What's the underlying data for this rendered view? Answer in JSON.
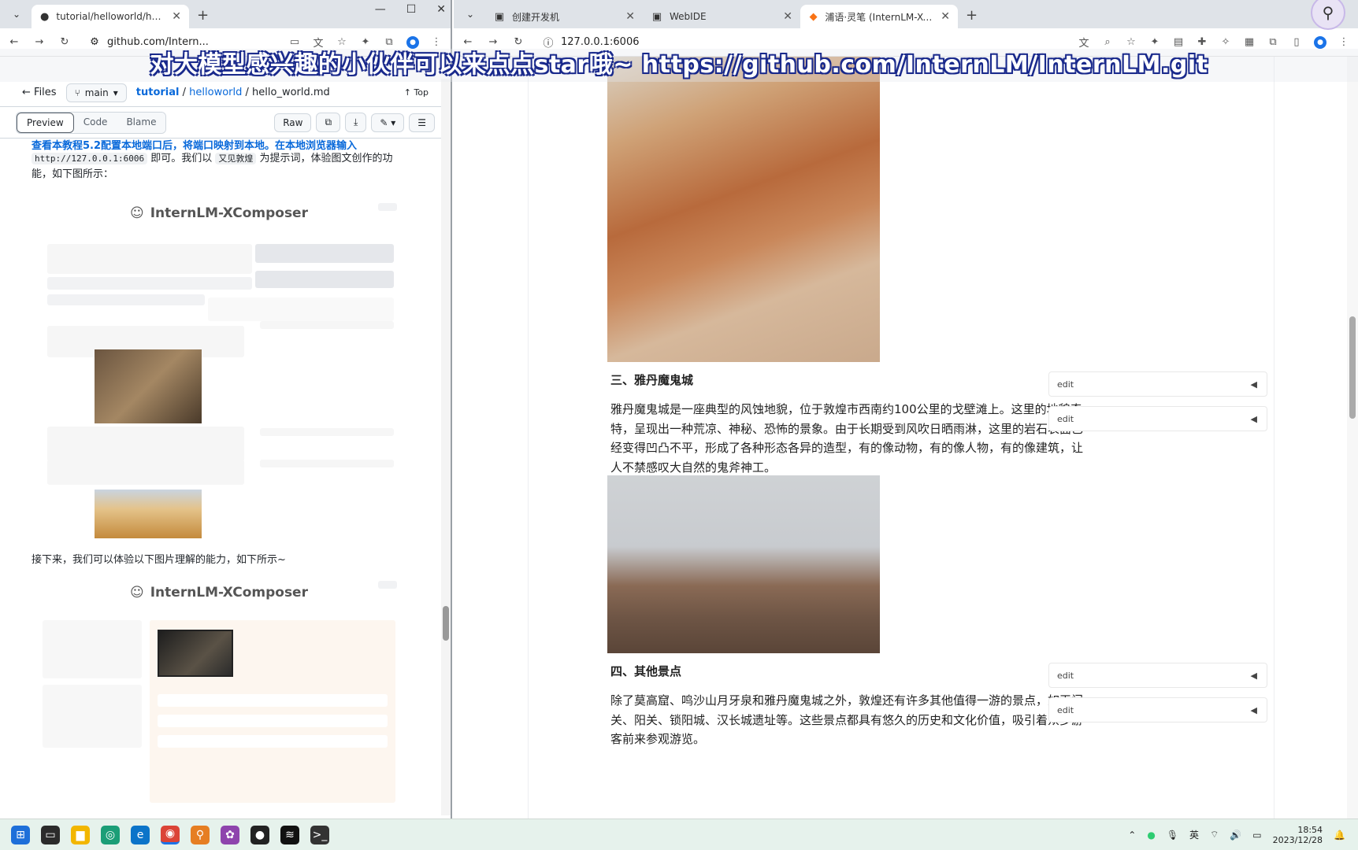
{
  "left_browser": {
    "tab_title": "tutorial/helloworld/hello_wo",
    "url": "github.com/Intern...",
    "github": {
      "files_label": "Files",
      "branch": "main",
      "breadcrumb": [
        "tutorial",
        "helloworld",
        "hello_world.md"
      ],
      "top_label": "Top",
      "view_tabs": [
        "Preview",
        "Code",
        "Blame"
      ],
      "raw_label": "Raw",
      "text_line1": "查看本教程5.2配置本地端口后，将端口映射到本地。在本地浏览器输入",
      "text_code": "http://127.0.0.1:6006",
      "text_line1_tail": "即可。我们以",
      "text_keyword": "又见敦煌",
      "text_line1_end": "为提示词，体验图文创作的功",
      "text_line2": "能，如下图所示：",
      "screenshot_title_1": "InternLM-XComposer",
      "screenshot_title_2": "InternLM-XComposer",
      "next_text": "接下来，我们可以体验以下图片理解的能力，如下所示~"
    }
  },
  "right_browser": {
    "tabs": [
      {
        "title": "创建开发机"
      },
      {
        "title": "WebIDE"
      },
      {
        "title": "浦语·灵笔 (InternLM-XCompo"
      }
    ],
    "url": "127.0.0.1:6006",
    "article": {
      "section3_heading": "三、雅丹魔鬼城",
      "section3_para": "雅丹魔鬼城是一座典型的风蚀地貌，位于敦煌市西南约100公里的戈壁滩上。这里的地貌奇特，呈现出一种荒凉、神秘、恐怖的景象。由于长期受到风吹日晒雨淋，这里的岩石表面已经变得凹凸不平，形成了各种形态各异的造型，有的像动物，有的像人物，有的像建筑，让人不禁感叹大自然的鬼斧神工。",
      "section4_heading": "四、其他景点",
      "section4_para": "除了莫高窟、鸣沙山月牙泉和雅丹魔鬼城之外，敦煌还有许多其他值得一游的景点，如玉门关、阳关、锁阳城、汉长城遗址等。这些景点都具有悠久的历史和文化价值，吸引着众多游客前来参观游览。",
      "edit_label": "edit"
    }
  },
  "overlay": {
    "banner": "对大模型感兴趣的小伙伴可以来点点star哦~ https://github.com/InternLM/InternLM.git"
  },
  "taskbar": {
    "ime": "英",
    "time": "18:54",
    "date": "2023/12/28"
  }
}
